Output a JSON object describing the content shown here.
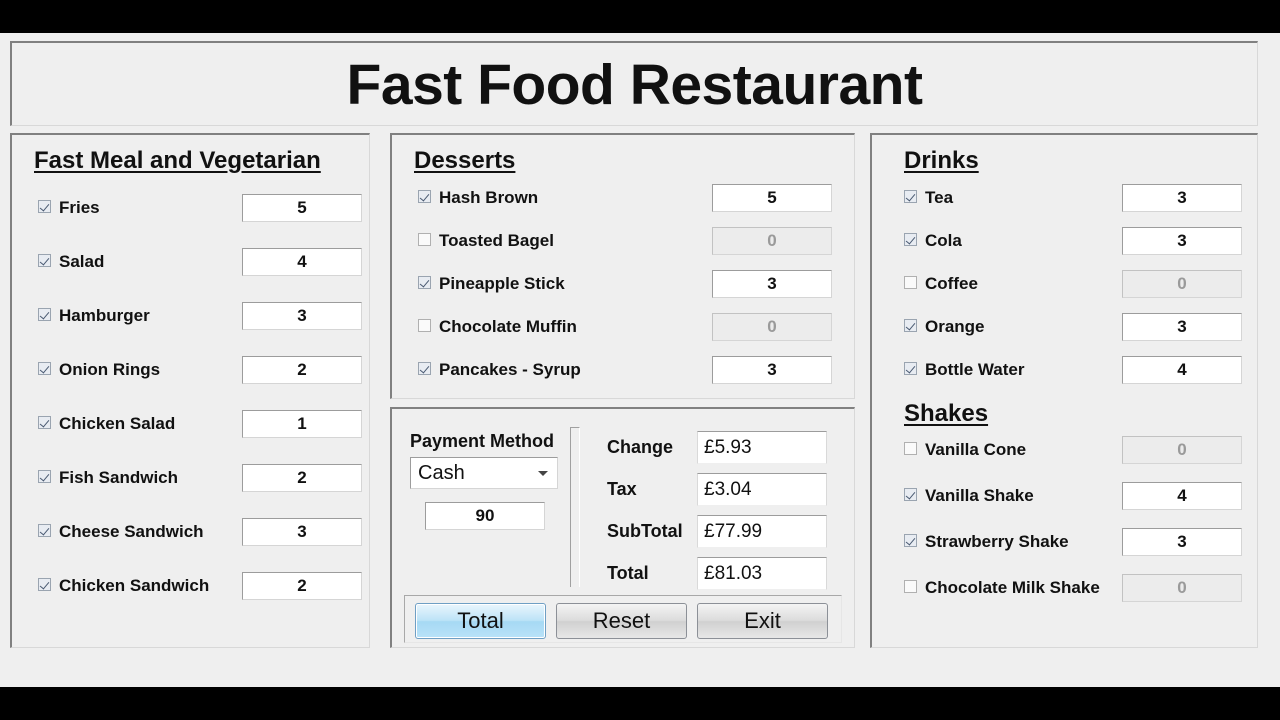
{
  "window": {
    "title": "Fast Food Restaurant"
  },
  "sections": {
    "fast_meal": {
      "title": "Fast Meal and Vegetarian",
      "items": [
        {
          "label": "Fries",
          "checked": true,
          "qty": "5"
        },
        {
          "label": "Salad",
          "checked": true,
          "qty": "4"
        },
        {
          "label": "Hamburger",
          "checked": true,
          "qty": "3"
        },
        {
          "label": "Onion Rings",
          "checked": true,
          "qty": "2"
        },
        {
          "label": "Chicken Salad",
          "checked": true,
          "qty": "1"
        },
        {
          "label": "Fish Sandwich",
          "checked": true,
          "qty": "2"
        },
        {
          "label": "Cheese Sandwich",
          "checked": true,
          "qty": "3"
        },
        {
          "label": "Chicken Sandwich",
          "checked": true,
          "qty": "2"
        }
      ]
    },
    "desserts": {
      "title": "Desserts",
      "items": [
        {
          "label": "Hash Brown",
          "checked": true,
          "qty": "5"
        },
        {
          "label": "Toasted Bagel",
          "checked": false,
          "qty": "0"
        },
        {
          "label": "Pineapple Stick",
          "checked": true,
          "qty": "3"
        },
        {
          "label": "Chocolate Muffin",
          "checked": false,
          "qty": "0"
        },
        {
          "label": "Pancakes - Syrup",
          "checked": true,
          "qty": "3"
        }
      ]
    },
    "drinks": {
      "title": "Drinks",
      "items": [
        {
          "label": "Tea",
          "checked": true,
          "qty": "3"
        },
        {
          "label": "Cola",
          "checked": true,
          "qty": "3"
        },
        {
          "label": "Coffee",
          "checked": false,
          "qty": "0"
        },
        {
          "label": "Orange",
          "checked": true,
          "qty": "3"
        },
        {
          "label": "Bottle Water",
          "checked": true,
          "qty": "4"
        }
      ]
    },
    "shakes": {
      "title": "Shakes",
      "items": [
        {
          "label": "Vanilla Cone",
          "checked": false,
          "qty": "0"
        },
        {
          "label": "Vanilla Shake",
          "checked": true,
          "qty": "4"
        },
        {
          "label": "Strawberry Shake",
          "checked": true,
          "qty": "3"
        },
        {
          "label": "Chocolate Milk Shake",
          "checked": false,
          "qty": "0"
        }
      ]
    }
  },
  "payment": {
    "method_label": "Payment Method",
    "method_value": "Cash",
    "method_options": [
      "Cash"
    ],
    "amount_value": "90",
    "summary": [
      {
        "label": "Change",
        "value": "£5.93"
      },
      {
        "label": "Tax",
        "value": "£3.04"
      },
      {
        "label": "SubTotal",
        "value": "£77.99"
      },
      {
        "label": "Total",
        "value": "£81.03"
      }
    ]
  },
  "buttons": [
    {
      "label": "Total",
      "primary": true
    },
    {
      "label": "Reset",
      "primary": false
    },
    {
      "label": "Exit",
      "primary": false
    }
  ],
  "colors": {
    "window_bg": "#efefef",
    "letterbox": "#000000",
    "primary_button": "#bde3f7",
    "field_bg": "#ffffff",
    "disabled_field_bg": "#ececec"
  }
}
